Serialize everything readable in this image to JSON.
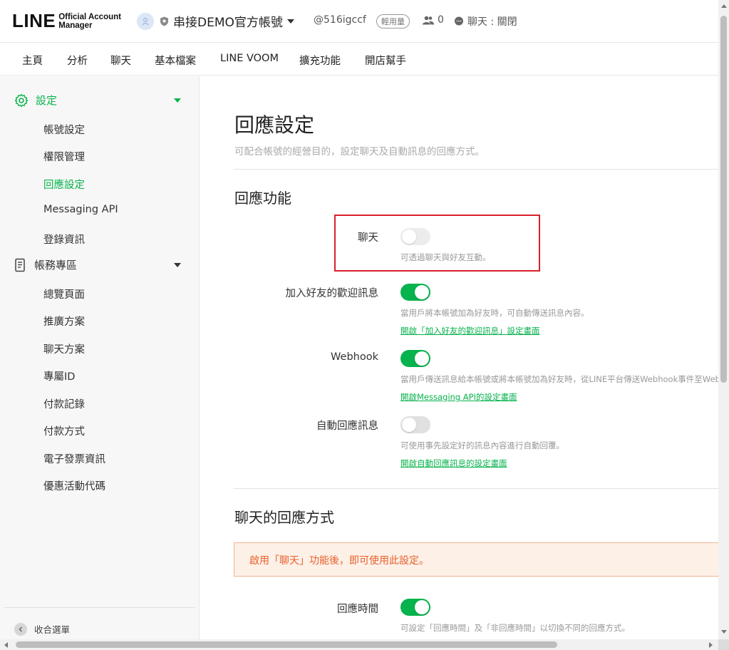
{
  "header": {
    "logo_main": "LINE",
    "logo_sub1": "Official Account",
    "logo_sub2": "Manager",
    "account_name": "串接DEMO官方帳號",
    "account_id": "@516igccf",
    "plan_badge": "輕用量",
    "friends_count": "0",
    "chat_status": "聊天 : 關閉"
  },
  "nav": {
    "items": [
      "主頁",
      "分析",
      "聊天",
      "基本檔案",
      "LINE VOOM",
      "擴充功能",
      "開店幫手"
    ]
  },
  "sidebar": {
    "settings_group": "設定",
    "settings_items": [
      "帳號設定",
      "權限管理",
      "回應設定",
      "Messaging API",
      "登錄資訊"
    ],
    "active_item": "回應設定",
    "billing_group": "帳務專區",
    "billing_items": [
      "總覽頁面",
      "推廣方案",
      "聊天方案",
      "專屬ID",
      "付款記錄",
      "付款方式",
      "電子發票資訊",
      "優惠活動代碼"
    ],
    "collapse_label": "收合選單"
  },
  "main": {
    "title": "回應設定",
    "description": "可配合帳號的經營目的，設定聊天及自動訊息的回應方式。",
    "section1_title": "回應功能",
    "rows": [
      {
        "label": "聊天",
        "state": "off",
        "help": "可透過聊天與好友互動。",
        "link": ""
      },
      {
        "label": "加入好友的歡迎訊息",
        "state": "on",
        "help": "當用戶將本帳號加為好友時，可自動傳送訊息內容。",
        "link": "開啟「加入好友的歡迎訊息」設定畫面"
      },
      {
        "label": "Webhook",
        "state": "on",
        "help": "當用戶傳送訊息給本帳號或將本帳號加為好友時，從LINE平台傳送Webhook事件至Web",
        "link": "開啟Messaging API的設定畫面"
      },
      {
        "label": "自動回應訊息",
        "state": "off",
        "help": "可使用事先設定好的訊息內容進行自動回覆。",
        "link": "開啟自動回應訊息的設定畫面"
      }
    ],
    "section2_title": "聊天的回應方式",
    "warning": "啟用「聊天」功能後，即可使用此設定。",
    "response_time_label": "回應時間",
    "response_time_state": "on",
    "response_time_help": "可設定「回應時間」及「非回應時間」以切換不同的回應方式。"
  },
  "colors": {
    "accent": "#06b34c",
    "highlight_border": "#d9202a",
    "warning_text": "#e8602c",
    "warning_bg": "#fdf0e7"
  }
}
